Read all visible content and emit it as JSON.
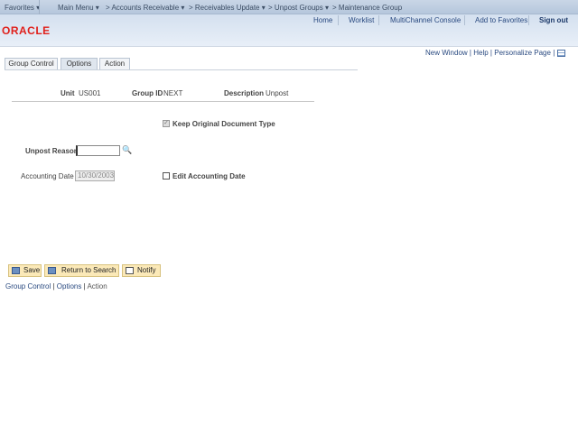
{
  "nav": {
    "favorites": "Favorites",
    "main_menu": "Main Menu",
    "crumbs": [
      "Accounts Receivable",
      "Receivables Update",
      "Unpost Groups",
      "Maintenance Group"
    ]
  },
  "header": {
    "links": [
      "Home",
      "Worklist",
      "MultiChannel Console",
      "Add to Favorites"
    ],
    "signout": "Sign out",
    "logo": "ORACLE"
  },
  "pagebar": {
    "new_window": "New Window",
    "help": "Help",
    "personalize": "Personalize Page"
  },
  "tabs": [
    "Group Control",
    "Options",
    "Action"
  ],
  "keys": {
    "unit_label": "Unit",
    "unit": "US001",
    "group_label": "Group ID",
    "group": "NEXT",
    "desc_label": "Description",
    "desc": "Unpost"
  },
  "form": {
    "keep_label": "Keep Original Document Type",
    "keep_checked": true,
    "reason_label": "Unpost Reason",
    "reason": "",
    "date_label": "Accounting Date",
    "date": "10/30/2003",
    "edit_date_label": "Edit Accounting Date",
    "edit_date_checked": false
  },
  "buttons": {
    "save": "Save",
    "return": "Return to Search",
    "notify": "Notify"
  },
  "footer_links": [
    "Group Control",
    "Options",
    "Action"
  ]
}
